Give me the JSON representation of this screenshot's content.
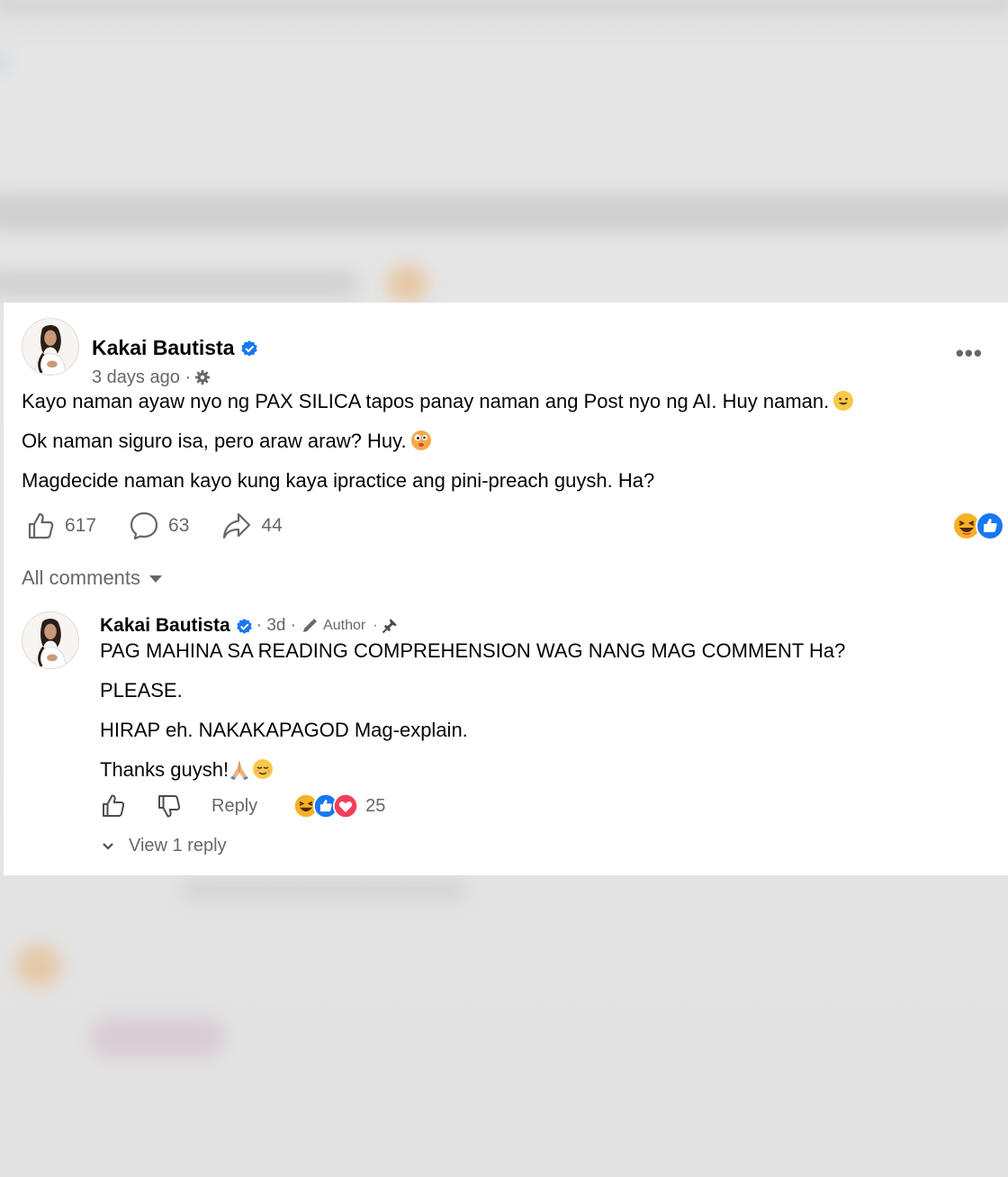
{
  "post": {
    "author": "Kakai Bautista",
    "time": "3 days ago ·",
    "more_label": "•••",
    "lines": [
      "Kayo naman ayaw nyo ng PAX SILICA tapos panay naman ang Post nyo ng AI. Huy naman.",
      "Ok naman siguro isa, pero araw araw? Huy.",
      "Magdecide naman kayo kung kaya ipractice ang pini-preach guysh. Ha?"
    ],
    "likes": "617",
    "comments": "63",
    "shares": "44"
  },
  "comments_header": "All comments",
  "comment": {
    "author": "Kakai Bautista",
    "time": "· 3d ·",
    "badge": "Author",
    "badge_sep": "·",
    "lines": [
      "PAG MAHINA SA READING COMPREHENSION WAG NANG MAG COMMENT Ha?",
      "PLEASE.",
      "HIRAP eh. NAKAKAPAGOD Mag-explain.",
      "Thanks guysh!"
    ],
    "reply_label": "Reply",
    "reaction_count": "25",
    "view_replies": "View 1 reply"
  },
  "colors": {
    "brand_blue": "#1877f2",
    "meta_gray": "#65676b",
    "love_red": "#f33e58",
    "haha_yellow": "#f7b125"
  },
  "icons": [
    "verified-badge-icon",
    "gear-icon",
    "more-icon",
    "like-icon",
    "comment-icon",
    "share-icon",
    "haha-reaction-icon",
    "like-reaction-icon",
    "love-reaction-icon",
    "pencil-icon",
    "pin-icon",
    "dislike-icon",
    "chevron-down-icon"
  ]
}
